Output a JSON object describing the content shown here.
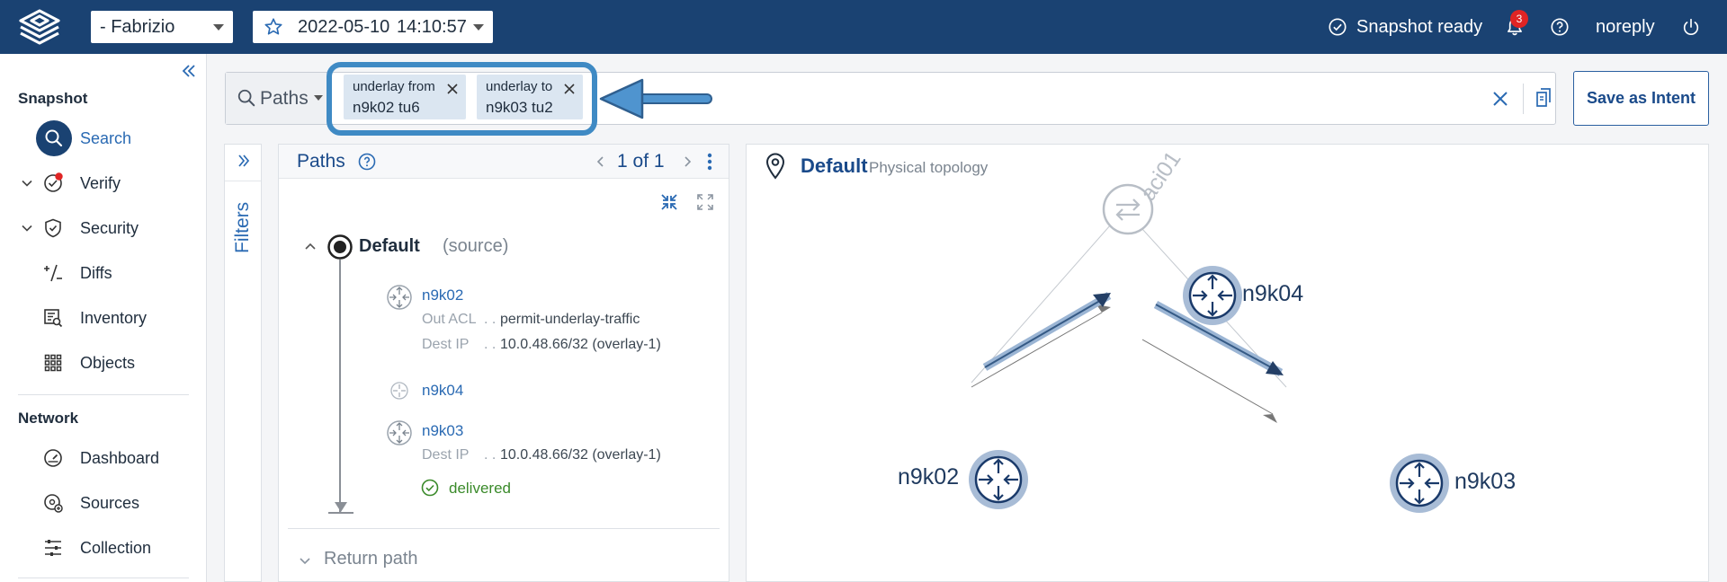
{
  "topbar": {
    "network_select": "- Fabrizio",
    "snapshot_date": "2022-05-10",
    "snapshot_time": "14:10:57",
    "status": "Snapshot ready",
    "notification_count": "3",
    "user": "noreply"
  },
  "sidebar": {
    "snapshot_title": "Snapshot",
    "network_title": "Network",
    "items": [
      {
        "label": "Search"
      },
      {
        "label": "Verify"
      },
      {
        "label": "Security"
      },
      {
        "label": "Diffs"
      },
      {
        "label": "Inventory"
      },
      {
        "label": "Objects"
      }
    ],
    "network_items": [
      {
        "label": "Dashboard"
      },
      {
        "label": "Sources"
      },
      {
        "label": "Collection"
      }
    ]
  },
  "search": {
    "mode": "Paths",
    "chips": [
      {
        "line1": "underlay  from",
        "line2": "n9k02 tu6"
      },
      {
        "line1": "underlay  to",
        "line2": "n9k03 tu2"
      }
    ],
    "save_label": "Save as Intent"
  },
  "filters": {
    "label": "Filters"
  },
  "paths": {
    "title": "Paths",
    "pager": "1 of 1",
    "source_name": "Default",
    "source_suffix": "(source)",
    "hops": [
      {
        "name": "n9k02",
        "details": [
          {
            "k": "Out ACL",
            "v": "permit-underlay-traffic"
          },
          {
            "k": "Dest IP",
            "v": "10.0.48.66/32 (overlay-1)"
          }
        ]
      },
      {
        "name": "n9k04",
        "details": []
      },
      {
        "name": "n9k03",
        "details": [
          {
            "k": "Dest IP",
            "v": "10.0.48.66/32 (overlay-1)"
          }
        ]
      }
    ],
    "result": "delivered",
    "return_path": "Return path"
  },
  "topology": {
    "title": "Default",
    "subtitle": "Physical topology",
    "nodes": {
      "aci01": "aci01",
      "n9k04": "n9k04",
      "n9k02": "n9k02",
      "n9k03": "n9k03"
    }
  },
  "colors": {
    "topbar": "#1a4272",
    "accent": "#2a6ab3",
    "highlight": "#3f8ac4",
    "delivered": "#3a8a2a"
  }
}
